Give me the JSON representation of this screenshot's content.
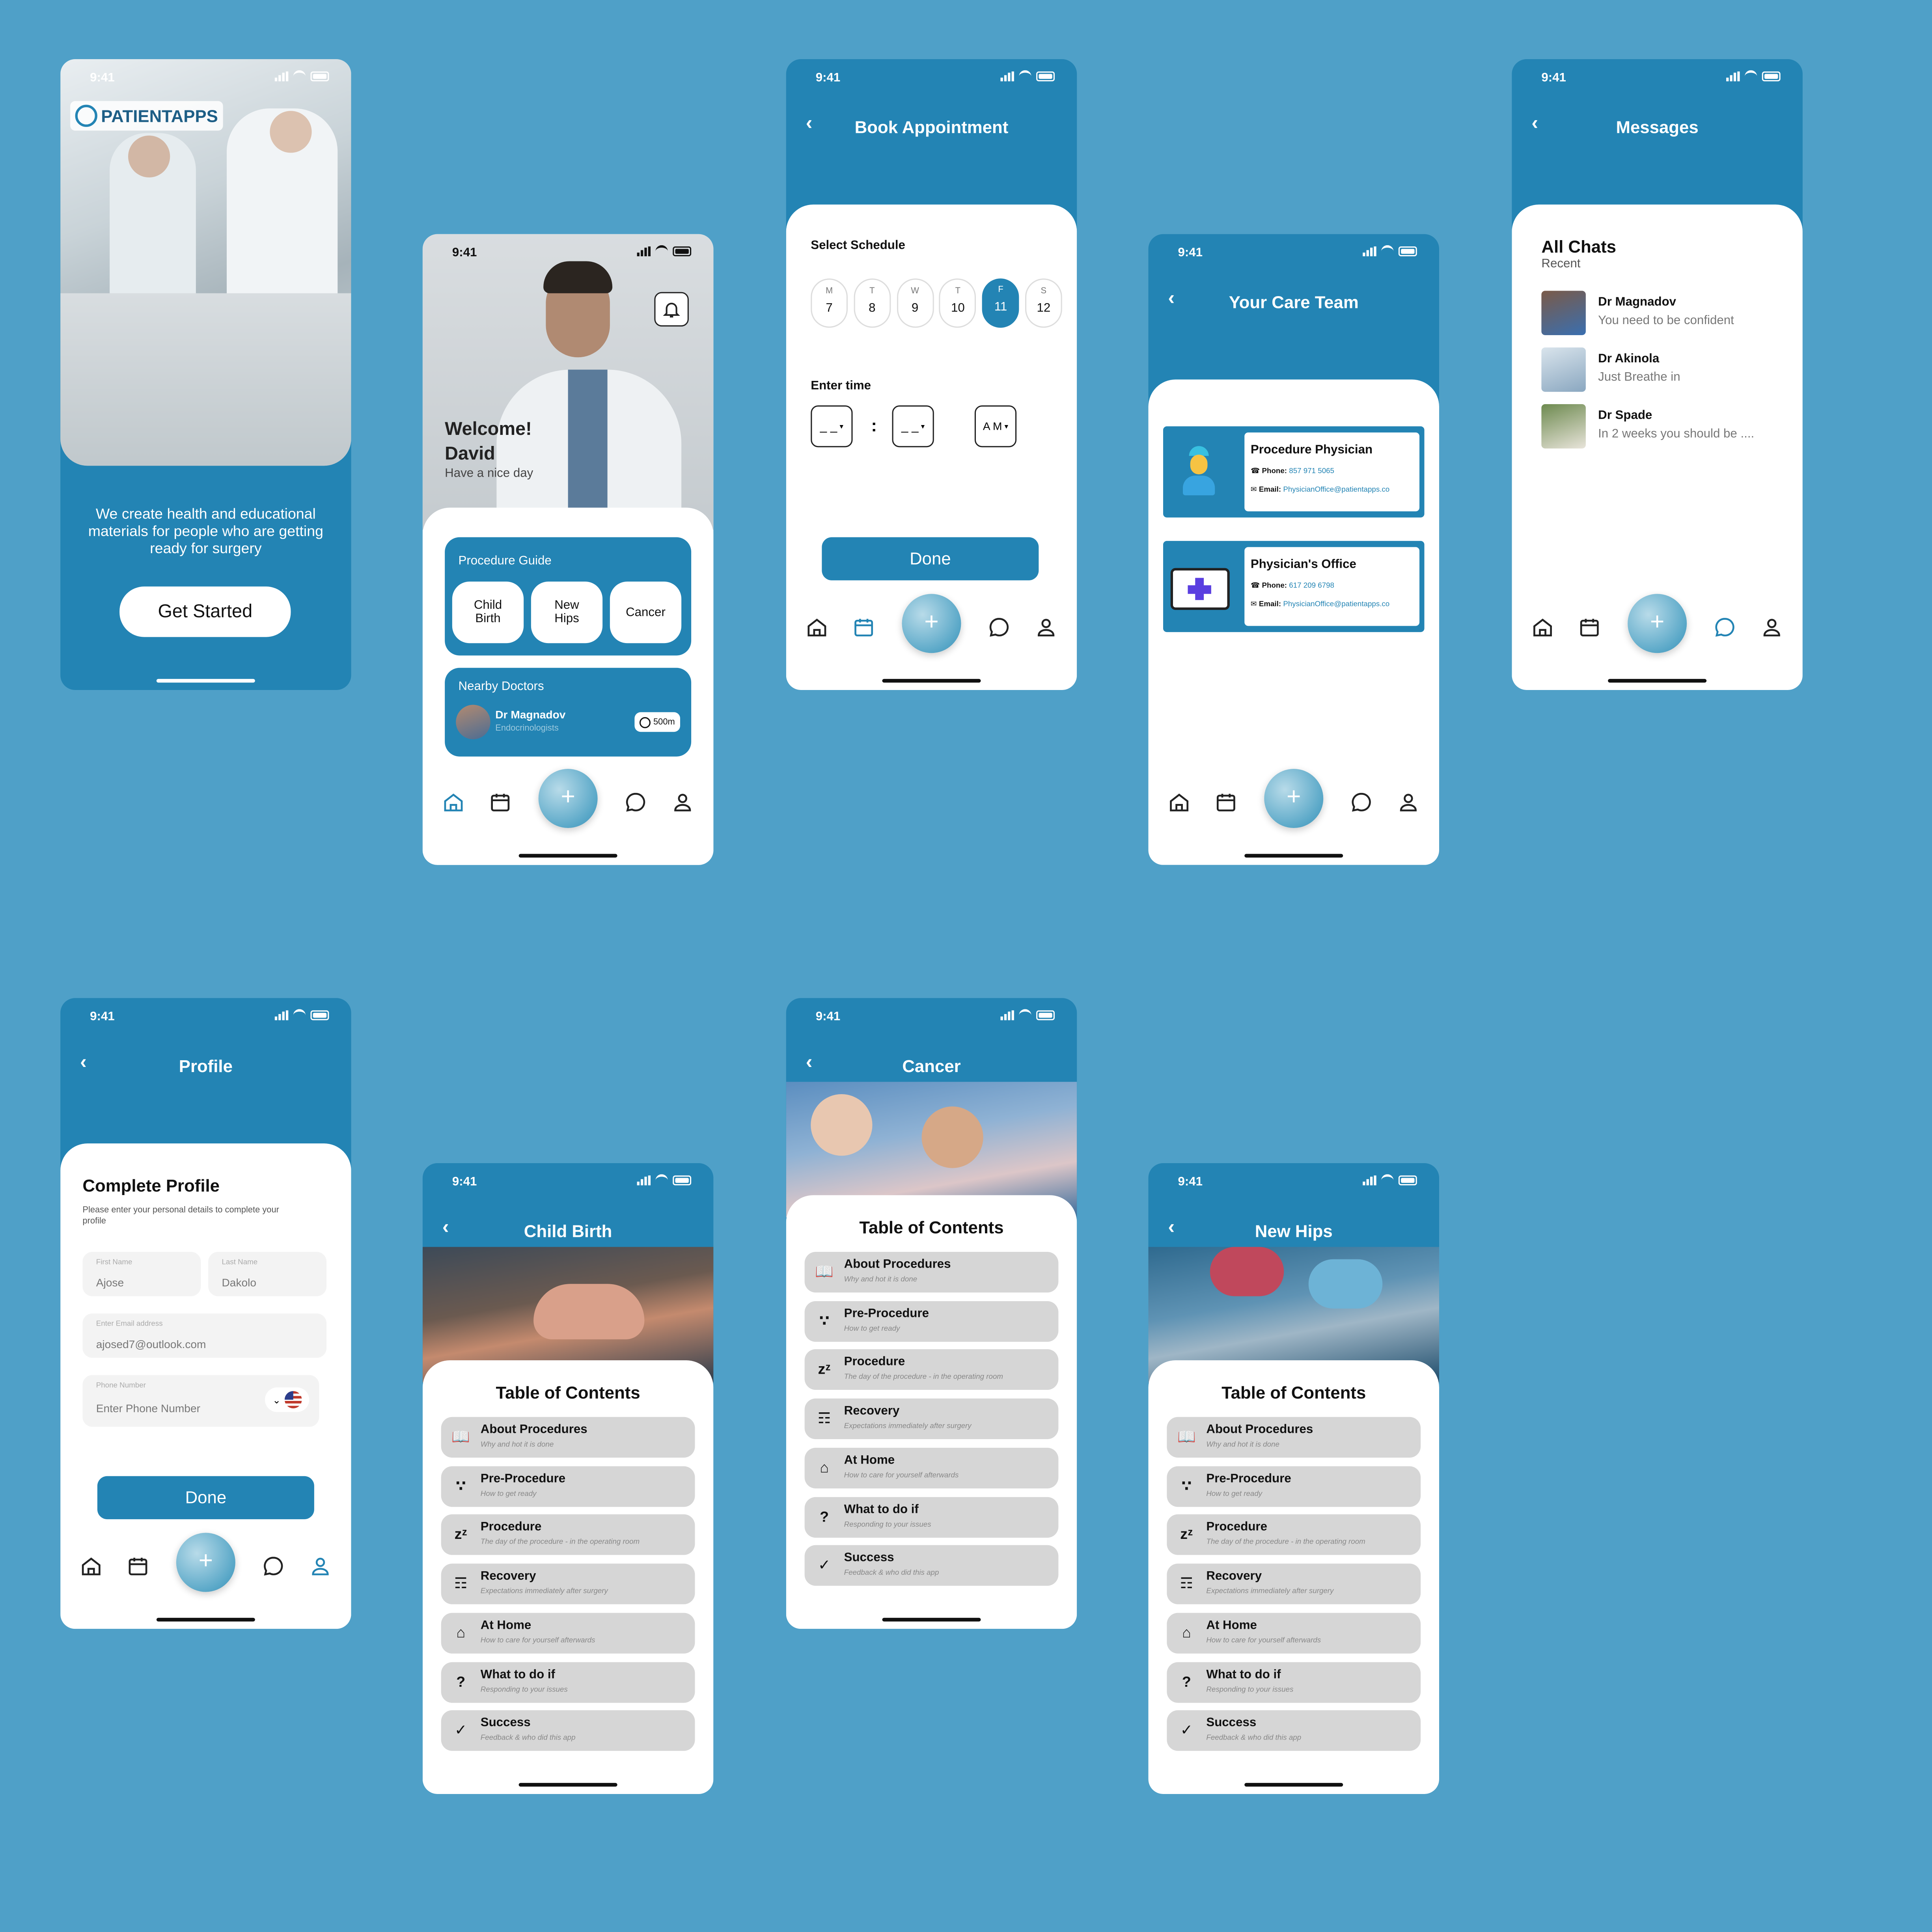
{
  "colors": {
    "background": "#4fa0c8",
    "primary": "#2384b4",
    "sheet": "#ffffff",
    "toc_item": "#d6d6d6",
    "link": "#2384b4"
  },
  "status_time": "9:41",
  "welcome": {
    "logo_text": "PATIENTAPPS",
    "tagline": "We create health and educational materials for people who are getting ready for surgery",
    "cta": "Get Started"
  },
  "home": {
    "greeting": "Welcome!",
    "name": "David",
    "sub": "Have a nice day",
    "guide_title": "Procedure Guide",
    "guide_buttons": [
      "Child Birth",
      "New Hips",
      "Cancer"
    ],
    "nearby_title": "Nearby Doctors",
    "doctor_name": "Dr Magnadov",
    "doctor_specialty": "Endocrinologists",
    "distance": "500m"
  },
  "book": {
    "title": "Book Appointment",
    "schedule_label": "Select Schedule",
    "days": [
      {
        "d": "M",
        "n": "7"
      },
      {
        "d": "T",
        "n": "8"
      },
      {
        "d": "W",
        "n": "9"
      },
      {
        "d": "T",
        "n": "10"
      },
      {
        "d": "F",
        "n": "11"
      },
      {
        "d": "S",
        "n": "12"
      }
    ],
    "selected_day_index": 4,
    "time_label": "Enter time",
    "hour": "_ _",
    "minute": "_ _",
    "colon": ":",
    "ampm": "A M",
    "done": "Done"
  },
  "care": {
    "title": "Your Care Team",
    "cards": [
      {
        "title": "Procedure Physician",
        "phone_label": "Phone:",
        "phone": "857 971 5065",
        "email_label": "Email:",
        "email": "PhysicianOffice@patientapps.co"
      },
      {
        "title": "Physician's Office",
        "phone_label": "Phone:",
        "phone": "617 209 6798",
        "email_label": "Email:",
        "email": "PhysicianOffice@patientapps.co"
      }
    ]
  },
  "messages": {
    "title": "Messages",
    "heading": "All Chats",
    "sub": "Recent",
    "chats": [
      {
        "name": "Dr Magnadov",
        "preview": "You need to be confident"
      },
      {
        "name": "Dr Akinola",
        "preview": "Just Breathe in"
      },
      {
        "name": "Dr Spade",
        "preview": "In 2 weeks you should be ...."
      }
    ]
  },
  "profile": {
    "title": "Profile",
    "heading": "Complete Profile",
    "sub": "Please enter your personal details to complete your profile",
    "first_label": "First Name",
    "first_value": "Ajose",
    "last_label": "Last Name",
    "last_value": "Dakolo",
    "email_label": "Enter Email address",
    "email_value": "ajosed7@outlook.com",
    "phone_label": "Phone Number",
    "phone_placeholder": "Enter Phone Number",
    "done": "Done"
  },
  "toc_heading": "Table of Contents",
  "toc_items": [
    {
      "title": "About Procedures",
      "sub": "Why and hot it is done",
      "icon": "book-icon"
    },
    {
      "title": "Pre-Procedure",
      "sub": "How to get ready",
      "icon": "steps-icon"
    },
    {
      "title": "Procedure",
      "sub": "The day of the procedure - in the operating room",
      "icon": "sleep-icon"
    },
    {
      "title": "Recovery",
      "sub": "Expectations immediately after surgery",
      "icon": "bed-icon"
    },
    {
      "title": "At Home",
      "sub": "How to care for yourself afterwards",
      "icon": "home-icon"
    },
    {
      "title": "What to do if",
      "sub": "Responding to your issues",
      "icon": "question-icon"
    },
    {
      "title": "Success",
      "sub": "Feedback & who did this app",
      "icon": "check-icon"
    }
  ],
  "screens": {
    "child_birth": "Child Birth",
    "cancer": "Cancer",
    "new_hips": "New Hips"
  }
}
